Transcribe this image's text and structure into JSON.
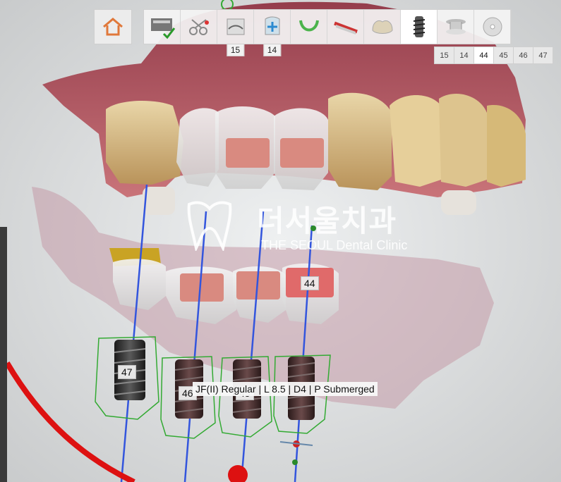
{
  "toolbar": {
    "steps": [
      {
        "name": "home"
      },
      {
        "name": "scan-data",
        "checked": true
      },
      {
        "name": "tooth-selection"
      },
      {
        "name": "margin-design",
        "badge": "15"
      },
      {
        "name": "insertion-axis",
        "badge": "14"
      },
      {
        "name": "arch-design"
      },
      {
        "name": "gingiva-design"
      },
      {
        "name": "crown-library"
      },
      {
        "name": "implant-design",
        "active": true
      },
      {
        "name": "abutment-design"
      },
      {
        "name": "export"
      }
    ],
    "badge_15": "15",
    "badge_14": "14"
  },
  "tooth_tabs": [
    "15",
    "14",
    "44",
    "45",
    "46",
    "47"
  ],
  "active_tooth": "44",
  "implant_labels": {
    "t44": "44",
    "t45": "45",
    "t46": "46",
    "t47": "47"
  },
  "implant_info": "JF(II) Regular | L 8.5 | D4 | P Submerged",
  "watermark": {
    "korean": "더서울치과",
    "english": "THE SEOUL Dental Clinic"
  },
  "colors": {
    "implant_axis": "#3355dd",
    "gingiva": "#b5555e",
    "crown_preview": "#e08080",
    "arch_curve": "#dd1111",
    "safety_zone": "#33aa33"
  }
}
